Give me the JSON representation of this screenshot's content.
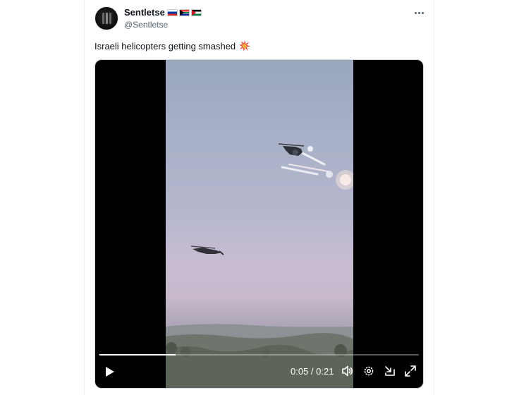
{
  "tweet": {
    "display_name": "Sentletse",
    "handle": "@Sentletse",
    "text": "Israeli helicopters getting smashed",
    "flags": [
      "russia-flag",
      "south-africa-flag",
      "palestine-flag"
    ],
    "emoji": "collision"
  },
  "video": {
    "time": "0:05 / 0:21",
    "progress": 0.238,
    "controls": [
      "play-icon",
      "volume-icon",
      "settings-icon",
      "minimize-icon",
      "fullscreen-icon"
    ]
  },
  "colors": {
    "text_primary": "#0f1419",
    "text_secondary": "#536471"
  }
}
